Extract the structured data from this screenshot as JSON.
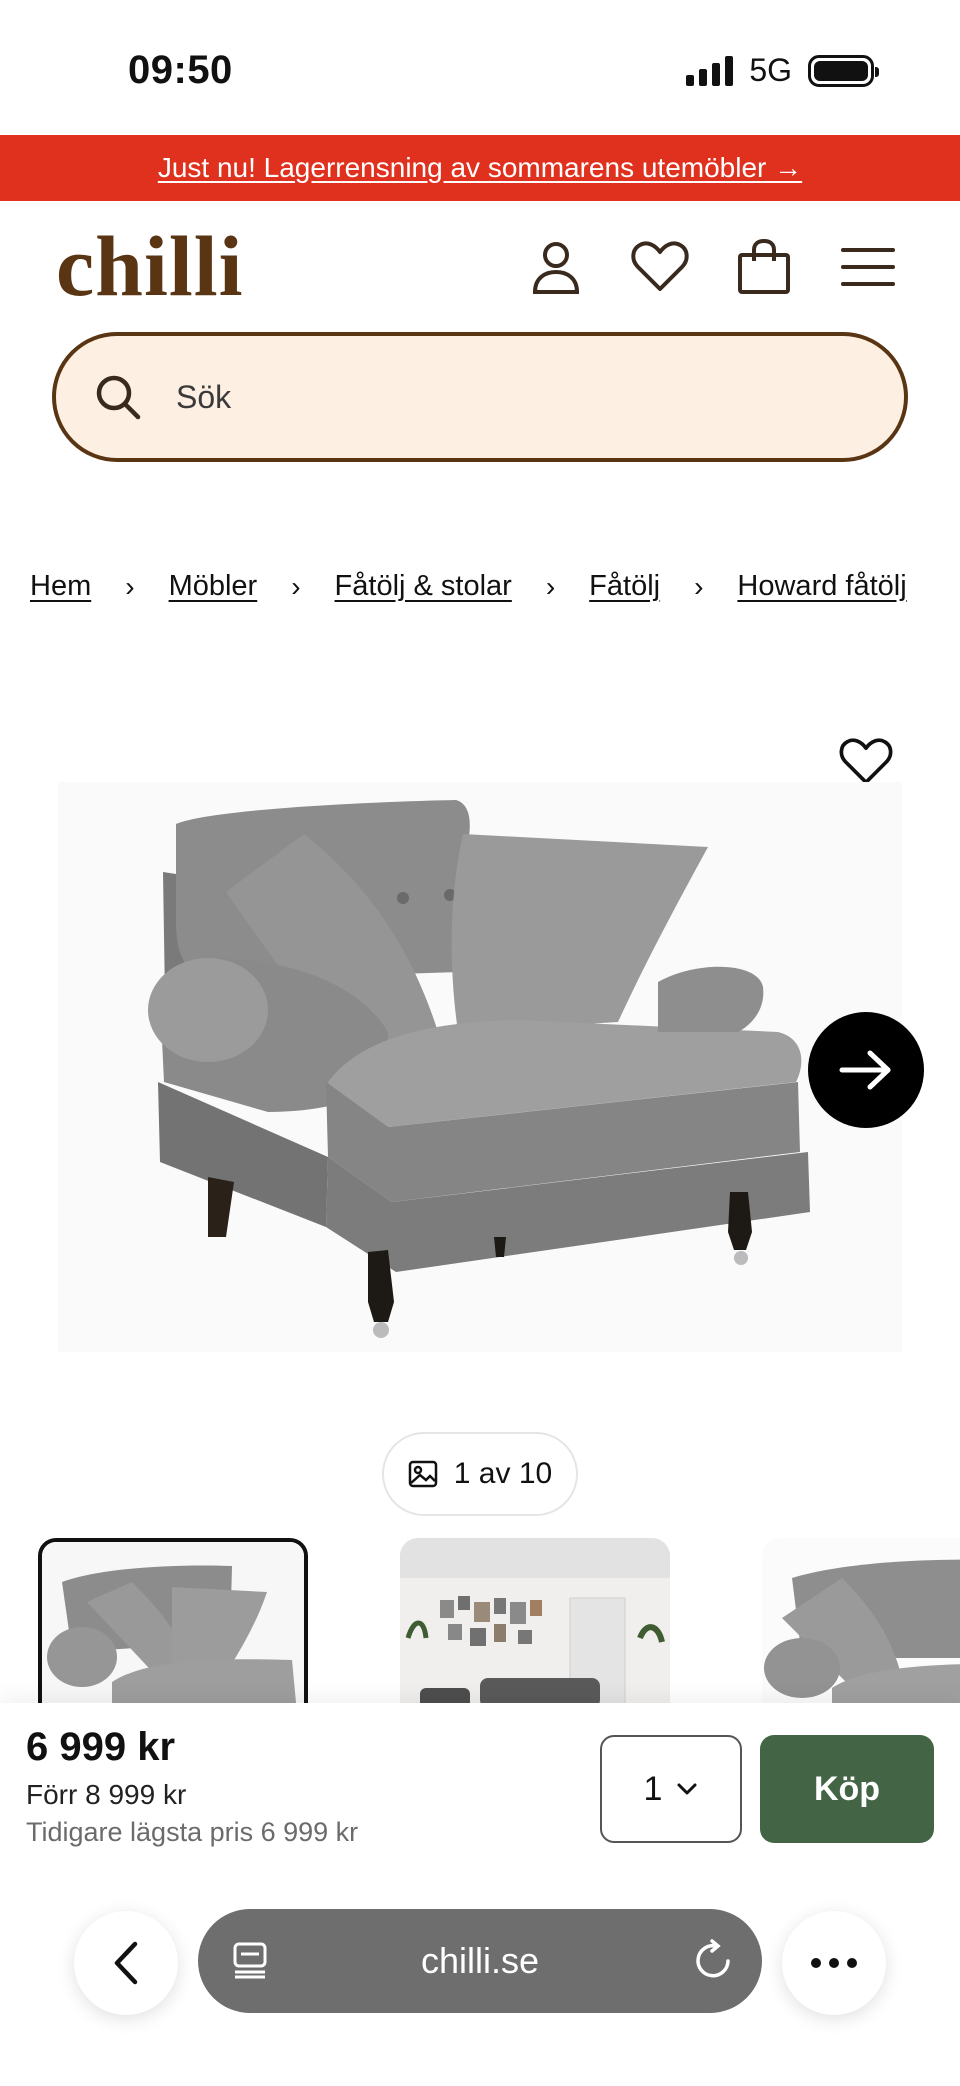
{
  "status_bar": {
    "time": "09:50",
    "network": "5G"
  },
  "promo": {
    "text": "Just nu! Lagerrensning av sommarens utemöbler →"
  },
  "header": {
    "logo": "chilli",
    "icons": [
      "user-icon",
      "heart-icon",
      "bag-icon",
      "menu-icon"
    ]
  },
  "search": {
    "placeholder": "Sök"
  },
  "breadcrumb": {
    "items": [
      "Hem",
      "Möbler",
      "Fåtölj & stolar",
      "Fåtölj",
      "Howard fåtölj"
    ],
    "separator": "›"
  },
  "gallery": {
    "counter": "1 av 10",
    "image_alt": "Howard fåtölj"
  },
  "buy_bar": {
    "price": "6 999 kr",
    "was_price": "Förr 8 999 kr",
    "lowest_price": "Tidigare lägsta pris 6 999 kr",
    "quantity": "1",
    "buy_label": "Köp",
    "buy_color": "#436546"
  },
  "browser": {
    "url": "chilli.se"
  },
  "colors": {
    "brand": "#5a3514",
    "promo": "#e0301e",
    "search_bg": "#fdefe2"
  }
}
